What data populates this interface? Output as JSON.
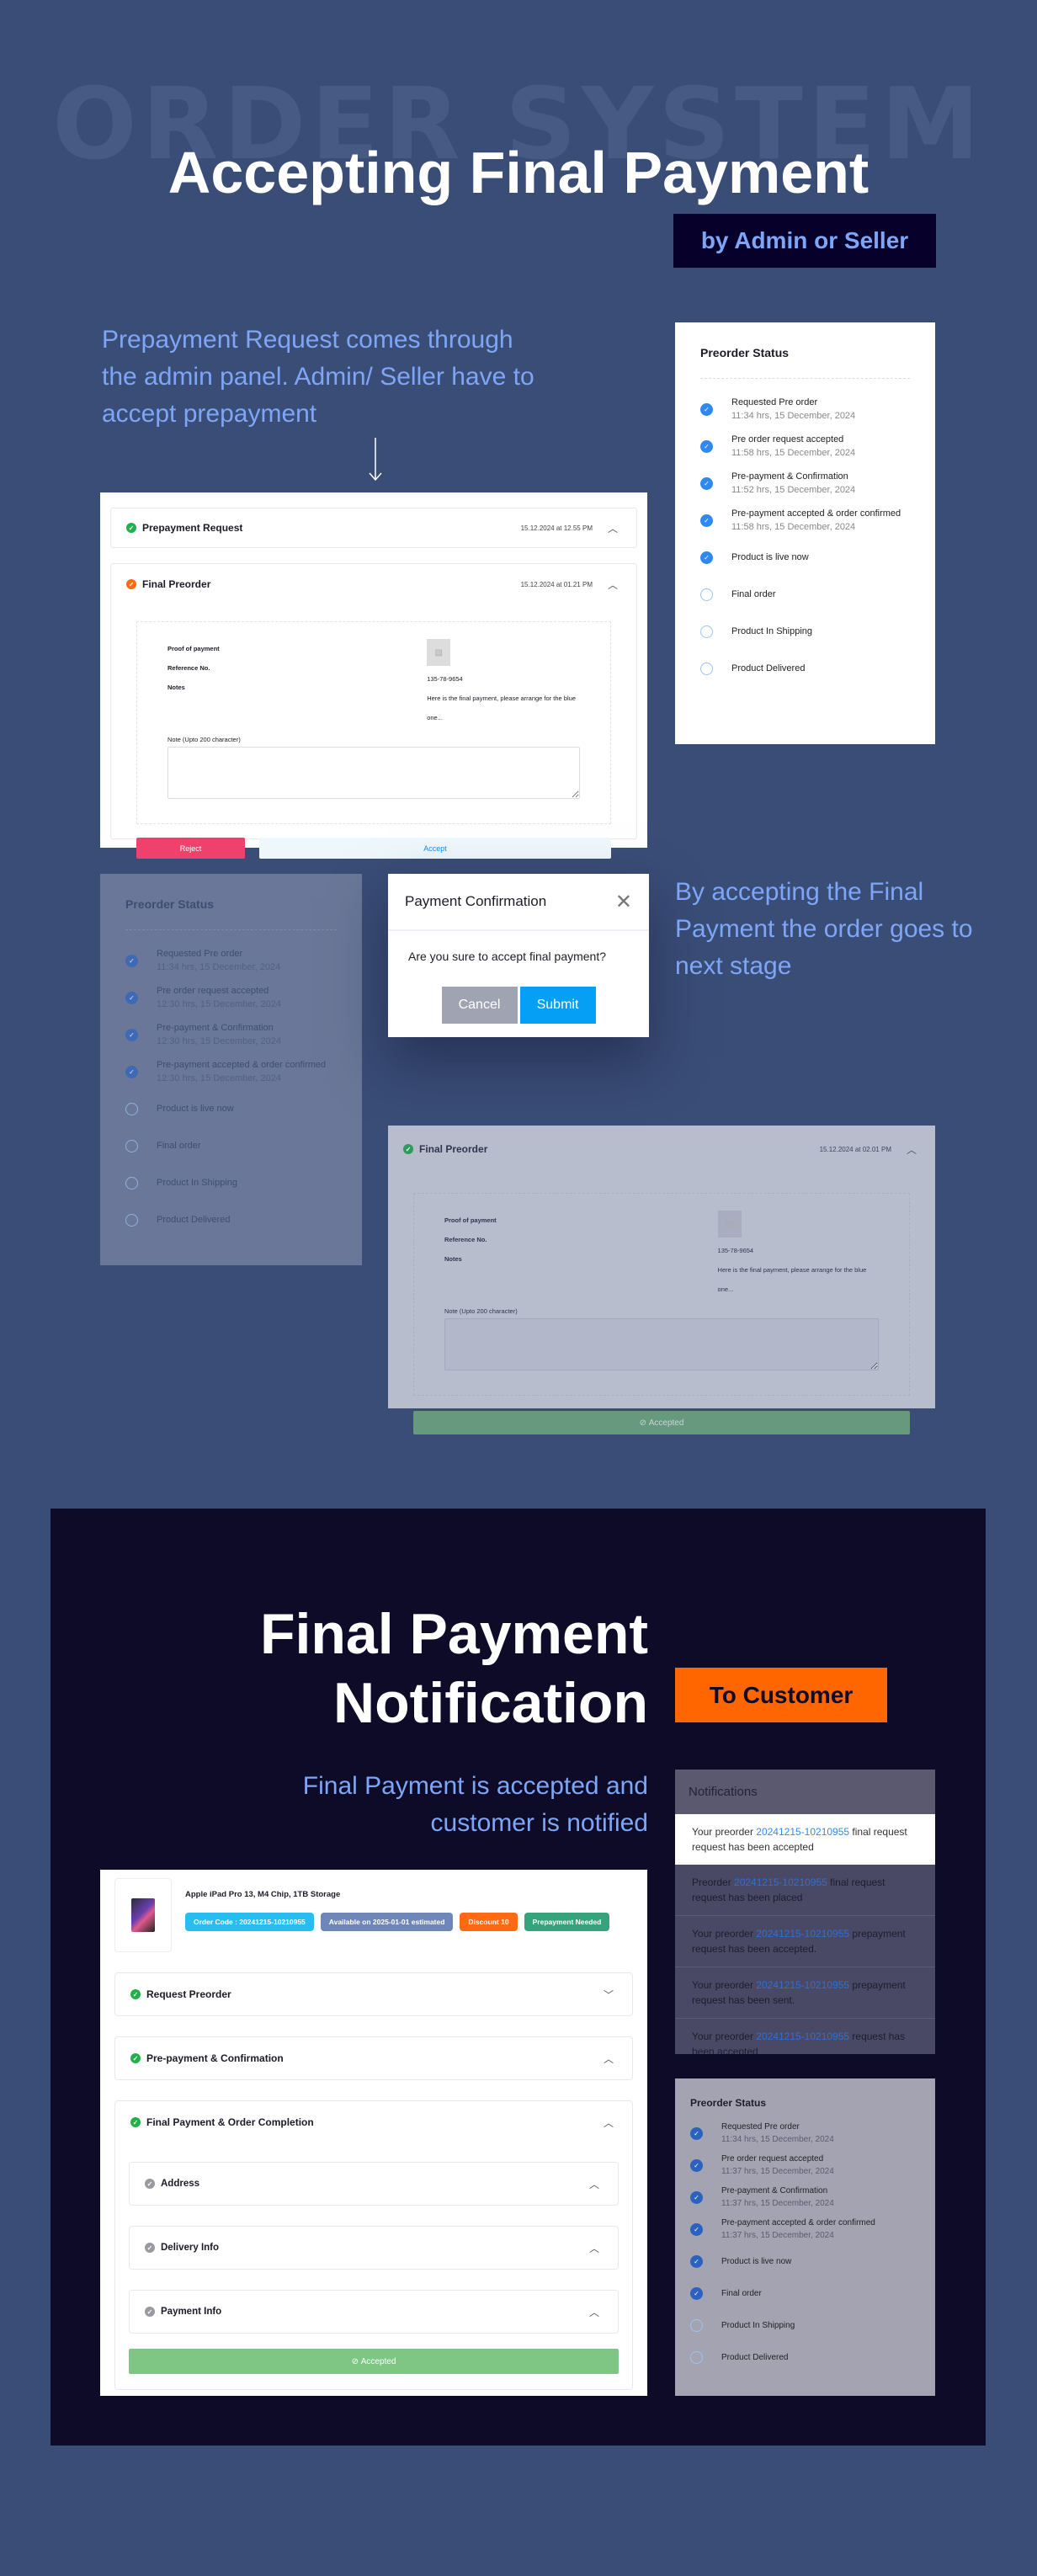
{
  "watermark": "ORDER SYSTEM",
  "section1": {
    "title": "Accepting Final Payment",
    "badge": "by Admin or Seller",
    "lead": "Prepayment Request comes through the admin panel. Admin/ Seller have to accept prepayment",
    "side_text": "By accepting the Final Payment the order goes to next stage"
  },
  "admin_panel": {
    "prepayment": {
      "title": "Prepayment Request",
      "date": "15.12.2024 at 12.55 PM"
    },
    "final": {
      "title": "Final Preorder",
      "date": "15.12.2024 at 01.21 PM"
    },
    "labels": {
      "proof": "Proof of payment",
      "ref": "Reference No.",
      "notes": "Notes"
    },
    "values": {
      "ref": "135-78-9654",
      "notes": "Here is the final payment, please arrange for the blue one..."
    },
    "note_label": "Note  (Upto 200 character)",
    "reject": "Reject",
    "accept": "Accept"
  },
  "status_title": "Preorder Status",
  "status1": [
    {
      "label": "Requested Pre order",
      "time": "11:34 hrs, 15 December, 2024",
      "done": true
    },
    {
      "label": "Pre order request accepted",
      "time": "11:58 hrs, 15 December, 2024",
      "done": true
    },
    {
      "label": "Pre-payment & Confirmation",
      "time": "11:52 hrs, 15 December, 2024",
      "done": true
    },
    {
      "label": "Pre-payment accepted & order confirmed",
      "time": "11:58 hrs, 15 December, 2024",
      "done": true
    },
    {
      "label": "Product is live now",
      "done": true
    },
    {
      "label": "Final order",
      "done": false
    },
    {
      "label": "Product In Shipping",
      "done": false
    },
    {
      "label": "Product Delivered",
      "done": false
    }
  ],
  "status2": [
    {
      "label": "Requested Pre order",
      "time": "11:34 hrs, 15 December, 2024",
      "done": true
    },
    {
      "label": "Pre order request accepted",
      "time": "12:30 hrs, 15 December, 2024",
      "done": true
    },
    {
      "label": "Pre-payment & Confirmation",
      "time": "12:30 hrs, 15 December, 2024",
      "done": true
    },
    {
      "label": "Pre-payment accepted & order confirmed",
      "time": "12:30 hrs, 15 December, 2024",
      "done": true
    },
    {
      "label": "Product is live now",
      "done": false
    },
    {
      "label": "Final order",
      "done": false
    },
    {
      "label": "Product In Shipping",
      "done": false
    },
    {
      "label": "Product Delivered",
      "done": false
    }
  ],
  "status3": [
    {
      "label": "Requested Pre order",
      "time": "11:34 hrs, 15 December, 2024",
      "done": true
    },
    {
      "label": "Pre order request accepted",
      "time": "11:37 hrs, 15 December, 2024",
      "done": true
    },
    {
      "label": "Pre-payment & Confirmation",
      "time": "11:37 hrs, 15 December, 2024",
      "done": true
    },
    {
      "label": "Pre-payment accepted & order confirmed",
      "time": "11:37 hrs, 15 December, 2024",
      "done": true
    },
    {
      "label": "Product is live now",
      "done": true
    },
    {
      "label": "Final order",
      "done": true
    },
    {
      "label": "Product In Shipping",
      "done": false
    },
    {
      "label": "Product Delivered",
      "done": false
    }
  ],
  "modal": {
    "title": "Payment Confirmation",
    "message": "Are you sure to accept final payment?",
    "cancel": "Cancel",
    "submit": "Submit"
  },
  "accepted_panel": {
    "title": "Final Preorder",
    "date": "15.12.2024 at 02.01 PM",
    "accepted": "Accepted"
  },
  "section2": {
    "title_line1": "Final Payment",
    "title_line2": "Notification",
    "badge": "To Customer",
    "lead_line1": "Final Payment is accepted and",
    "lead_line2": "customer is notified"
  },
  "notifications": {
    "title": "Notifications",
    "items": [
      {
        "pre": "Your preorder ",
        "code": "20241215-10210955",
        "post": " final request request has been accepted"
      },
      {
        "pre": "Preorder ",
        "code": "20241215-10210955",
        "post": " final request request has been placed"
      },
      {
        "pre": "Your preorder ",
        "code": "20241215-10210955",
        "post": " prepayment request has been accepted."
      },
      {
        "pre": "Your preorder ",
        "code": "20241215-10210955",
        "post": " prepayment request has been sent."
      },
      {
        "pre": "Your preorder ",
        "code": "20241215-10210955",
        "post": " request has been accepted"
      }
    ]
  },
  "customer": {
    "product": "Apple iPad Pro 13, M4 Chip, 1TB Storage",
    "pills": [
      {
        "text": "Order Code : 20241215-10210955",
        "color": "#27bdf0"
      },
      {
        "text": "Available on 2025-01-01 estimated",
        "color": "#6f86b8"
      },
      {
        "text": "Discount 10",
        "color": "#ff6a13"
      },
      {
        "text": "Prepayment Needed",
        "color": "#35a37c"
      }
    ],
    "sections": [
      "Request Preorder",
      "Pre-payment & Confirmation",
      "Final Payment & Order Completion"
    ],
    "subsections": [
      "Address",
      "Delivery Info",
      "Payment Info"
    ],
    "accepted": "Accepted"
  },
  "colors": {
    "background": "#3a4d76",
    "dark_section": "#0e0b29",
    "accent_text": "#7ea6f7",
    "orange": "#ff6600",
    "check_blue": "#2f89f0",
    "reject": "#f0406c",
    "submit": "#059ff5"
  }
}
